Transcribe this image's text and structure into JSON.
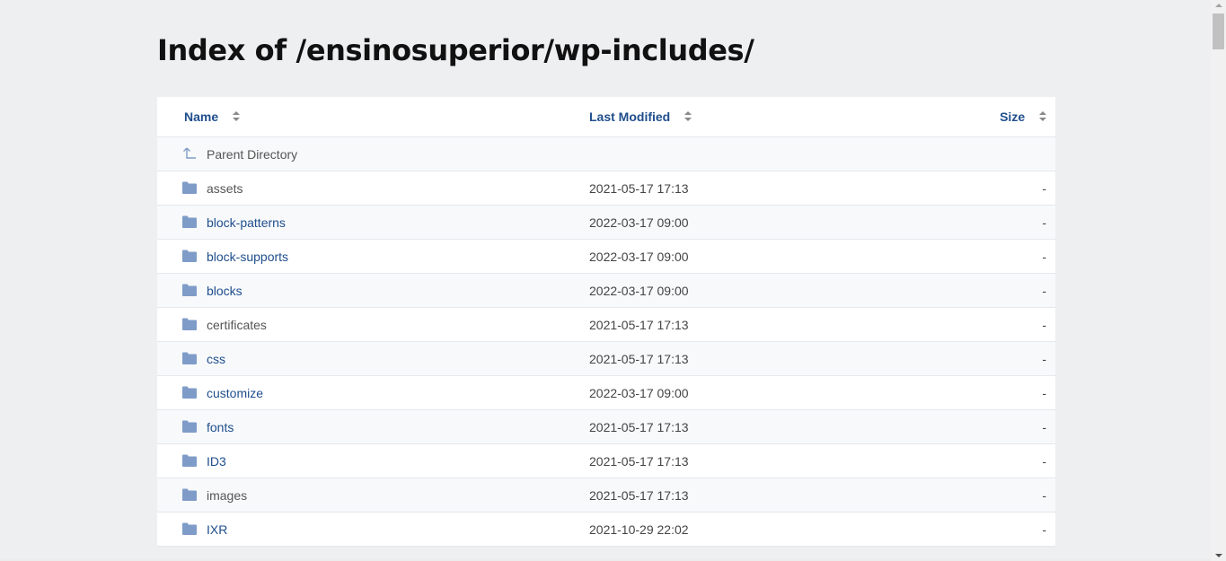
{
  "page": {
    "title": "Index of /ensinosuperior/wp-includes/"
  },
  "columns": {
    "name": "Name",
    "last_modified": "Last Modified",
    "size": "Size"
  },
  "parent": {
    "label": "Parent Directory",
    "icon": "parent-directory-icon"
  },
  "rows": [
    {
      "name": "assets",
      "date": "2021-05-17 17:13",
      "size": "-",
      "visited": true
    },
    {
      "name": "block-patterns",
      "date": "2022-03-17 09:00",
      "size": "-",
      "visited": false
    },
    {
      "name": "block-supports",
      "date": "2022-03-17 09:00",
      "size": "-",
      "visited": false
    },
    {
      "name": "blocks",
      "date": "2022-03-17 09:00",
      "size": "-",
      "visited": false
    },
    {
      "name": "certificates",
      "date": "2021-05-17 17:13",
      "size": "-",
      "visited": true
    },
    {
      "name": "css",
      "date": "2021-05-17 17:13",
      "size": "-",
      "visited": false
    },
    {
      "name": "customize",
      "date": "2022-03-17 09:00",
      "size": "-",
      "visited": false
    },
    {
      "name": "fonts",
      "date": "2021-05-17 17:13",
      "size": "-",
      "visited": false
    },
    {
      "name": "ID3",
      "date": "2021-05-17 17:13",
      "size": "-",
      "visited": false
    },
    {
      "name": "images",
      "date": "2021-05-17 17:13",
      "size": "-",
      "visited": true
    },
    {
      "name": "IXR",
      "date": "2021-10-29 22:02",
      "size": "-",
      "visited": false
    }
  ],
  "colors": {
    "link": "#1f4e8c",
    "visited": "#555555",
    "folder_icon": "#7f9cc8",
    "background": "#eeeff1"
  }
}
